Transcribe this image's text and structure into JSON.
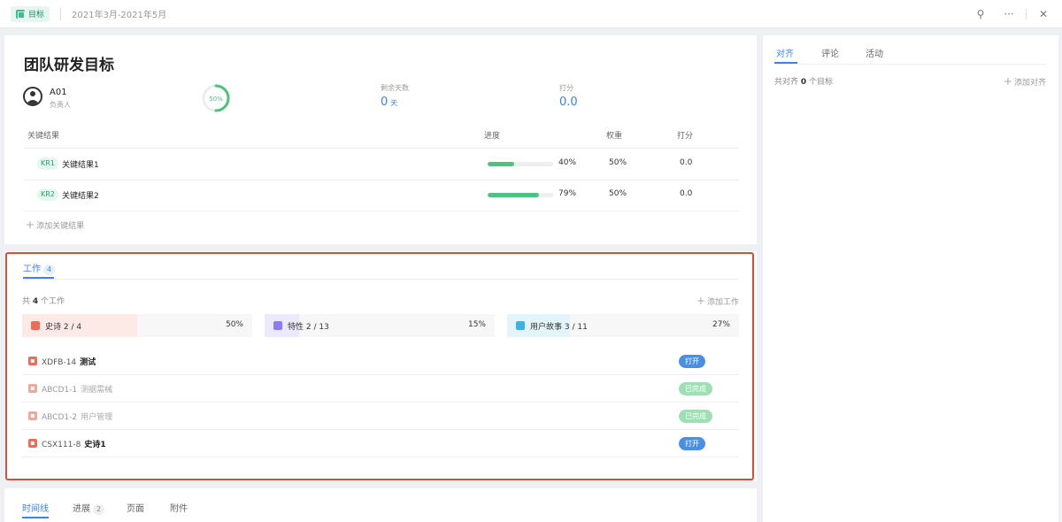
{
  "topbar": {
    "tag_label": "目标",
    "period": "2021年3月-2021年5月",
    "actions": [
      "unpin-icon",
      "more-icon",
      "close-icon"
    ]
  },
  "goal": {
    "title": "团队研发目标",
    "owner_name": "A01",
    "owner_role": "负责人",
    "progress_label": "50%",
    "progress_fraction": 0.5,
    "remaining_label": "剩余天数",
    "remaining_value": "0",
    "remaining_unit": "天",
    "score_label": "打分",
    "score_value": "0.0"
  },
  "kr_table": {
    "headers": {
      "name": "关键结果",
      "progress": "进度",
      "weight": "权重",
      "score": "打分"
    },
    "rows": [
      {
        "badge": "KR1",
        "name": "关键结果1",
        "progress": 0.4,
        "progress_label": "40%",
        "weight": "50%",
        "score": "0.0"
      },
      {
        "badge": "KR2",
        "name": "关键结果2",
        "progress": 0.79,
        "progress_label": "79%",
        "weight": "50%",
        "score": "0.0"
      }
    ],
    "add_label": "添加关键结果"
  },
  "work": {
    "tab_label": "工作",
    "tab_count": "4",
    "total_prefix": "共",
    "total_count": "4",
    "total_suffix": "个工作",
    "add_label": "添加工作",
    "summaries": [
      {
        "icon": "epic-icon",
        "label": "史诗 2 / 4",
        "pct": "50%",
        "fraction": 0.5,
        "color": "#f06a5a",
        "fill": "#fde9e6"
      },
      {
        "icon": "feature-icon",
        "label": "特性 2 / 13",
        "pct": "15%",
        "fraction": 0.15,
        "color": "#8b7cf6",
        "fill": "#ece9fd"
      },
      {
        "icon": "story-icon",
        "label": "用户故事 3 / 11",
        "pct": "27%",
        "fraction": 0.27,
        "color": "#3bb3e6",
        "fill": "#e3f4fb"
      }
    ],
    "items": [
      {
        "id": "XDFB-14",
        "title": "测试",
        "status": "打开",
        "done": false
      },
      {
        "id": "ABCD1-1",
        "title": "测据需械",
        "status": "已完成",
        "done": true
      },
      {
        "id": "ABCD1-2",
        "title": "用户管理",
        "status": "已完成",
        "done": true
      },
      {
        "id": "CSX111-8",
        "title": "史诗1",
        "status": "打开",
        "done": false
      }
    ]
  },
  "bottom_tabs": {
    "timeline": "时间线",
    "progress": "进展",
    "progress_count": "2",
    "page": "页面",
    "attachment": "附件"
  },
  "side": {
    "tabs": [
      "对齐",
      "评论",
      "活动"
    ],
    "count_prefix": "共对齐",
    "count_value": "0",
    "count_suffix": "个目标",
    "add_label": "添加对齐"
  },
  "colors": {
    "accent": "#3b82f6",
    "success": "#4cc37f",
    "highlight_border": "#e0493a"
  }
}
